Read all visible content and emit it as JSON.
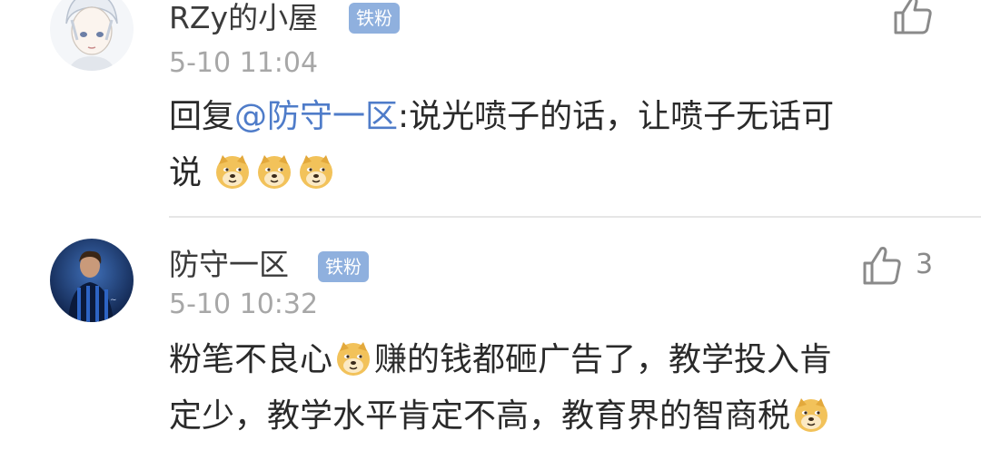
{
  "comments": [
    {
      "username": "RZy的小屋",
      "badge": "铁粉",
      "time": "5-10 11:04",
      "reply_prefix": "回复",
      "mention": "@防守一区",
      "text_line1": ":说光喷子的话，让喷子无话可",
      "text_line2": "说",
      "like_count": "",
      "icons": {
        "avatar": "anime-avatar-icon",
        "like": "thumbs-up-icon",
        "emoji": "doge-emoji-icon"
      }
    },
    {
      "username": "防守一区",
      "badge": "铁粉",
      "time": "5-10 10:32",
      "text_part1": "粉笔不良心",
      "text_part2": "赚的钱都砸广告了，教学投入肯",
      "text_line2": "定少，教学水平肯定不高，教育界的智商税",
      "like_count": "3",
      "icons": {
        "avatar": "football-player-avatar-icon",
        "like": "thumbs-up-icon",
        "emoji": "doge-emoji-icon"
      }
    }
  ],
  "colors": {
    "badge": "#8fb0de",
    "mention": "#4f7cc9",
    "time": "#a7a7a7",
    "divider": "#e6e6e6"
  }
}
